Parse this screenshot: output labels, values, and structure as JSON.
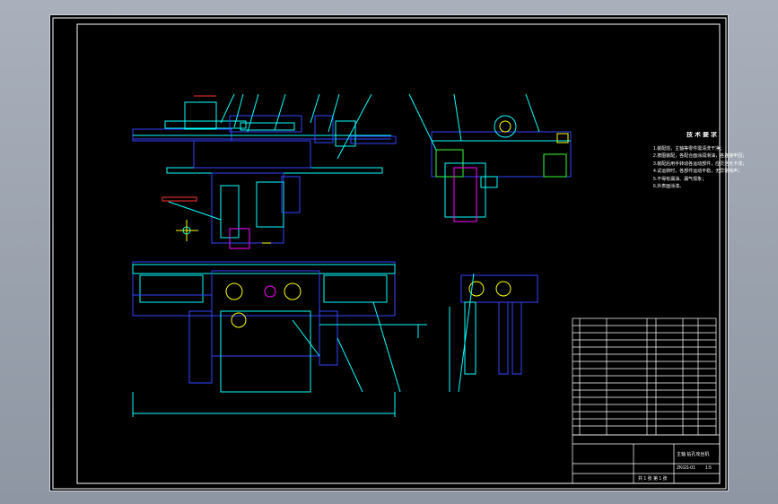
{
  "notes": {
    "title": "技术要求",
    "items": [
      "1.装配前，主轴等零件需清洗干净；",
      "2.按图装配，各配合面涂润滑油，各连接牢固；",
      "3.装配后用手转动各运动部件，应灵活无卡滞；",
      "4.试运转时，各部件运动平稳，无异常噪声；",
      "5.不得有漏油、漏气现象；",
      "6.外表面涂漆。"
    ]
  },
  "title_block": {
    "product": "主轴  钻孔攻丝机",
    "code": "ZKGS-01",
    "sheet": "共 1 张  第 1 张",
    "scale": "1:5"
  },
  "colors": {
    "background": "#000000",
    "frame": "#ffffff",
    "cyan": "#00ffff",
    "blue": "#3344ff",
    "yellow": "#ffff00",
    "magenta": "#ff00ff",
    "red": "#ff3333",
    "green": "#33ff33"
  }
}
